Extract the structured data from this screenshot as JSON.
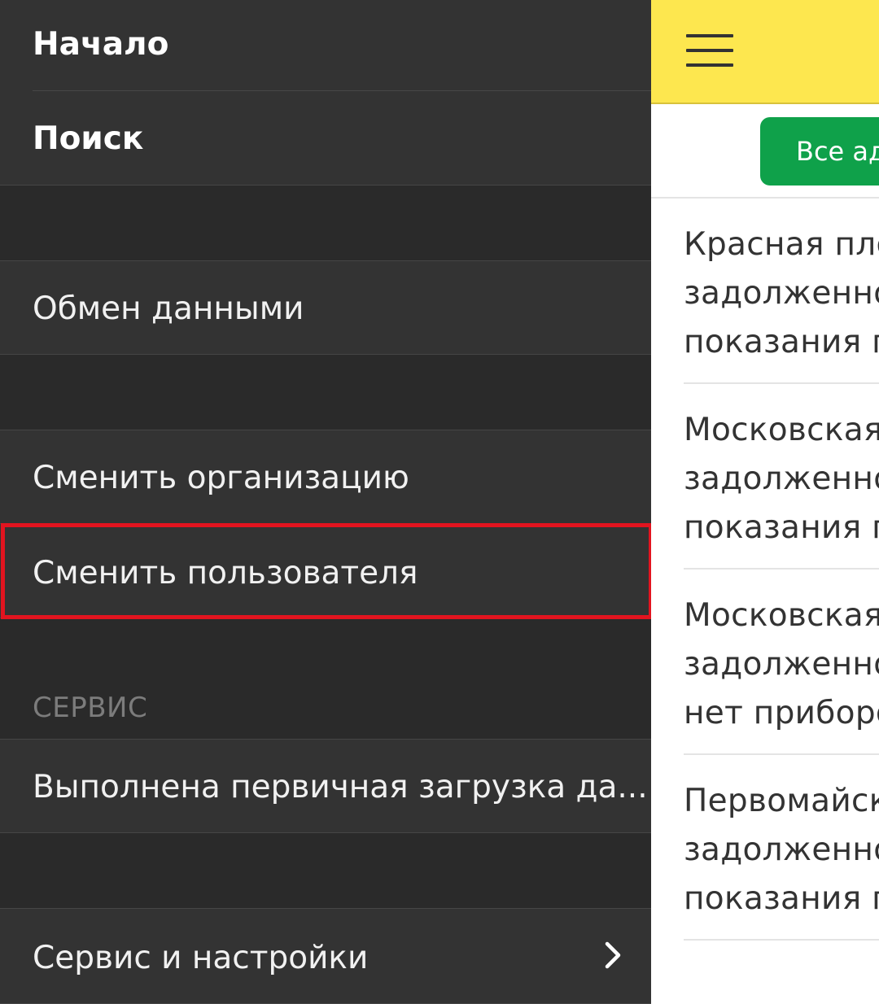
{
  "menu": {
    "start": "Начало",
    "search": "Поиск",
    "data_exchange": "Обмен данными",
    "change_org": "Сменить организацию",
    "change_user": "Сменить пользователя",
    "section_service": "СЕРВИС",
    "initial_load": "Выполнена первичная загрузка да...",
    "service_settings": "Сервис и настройки"
  },
  "main": {
    "filter_button": "Все адреса",
    "items": [
      {
        "line1": "Красная площадь",
        "line2": "задолженность",
        "line3": "показания п"
      },
      {
        "line1": "Московская",
        "line2": "задолженность",
        "line3": "показания п"
      },
      {
        "line1": "Московская",
        "line2": "задолженность",
        "line3": "нет приборов"
      },
      {
        "line1": "Первомайская",
        "line2": "задолженность",
        "line3": "показания п"
      }
    ]
  },
  "colors": {
    "drawer_bg": "#2a2a2a",
    "row_bg": "#333333",
    "topbar_yellow": "#fde74f",
    "button_green": "#0fa14a",
    "highlight_red": "#e2141f"
  },
  "icons": {
    "menu": "hamburger-icon",
    "submenu": "chevron-right-icon"
  }
}
